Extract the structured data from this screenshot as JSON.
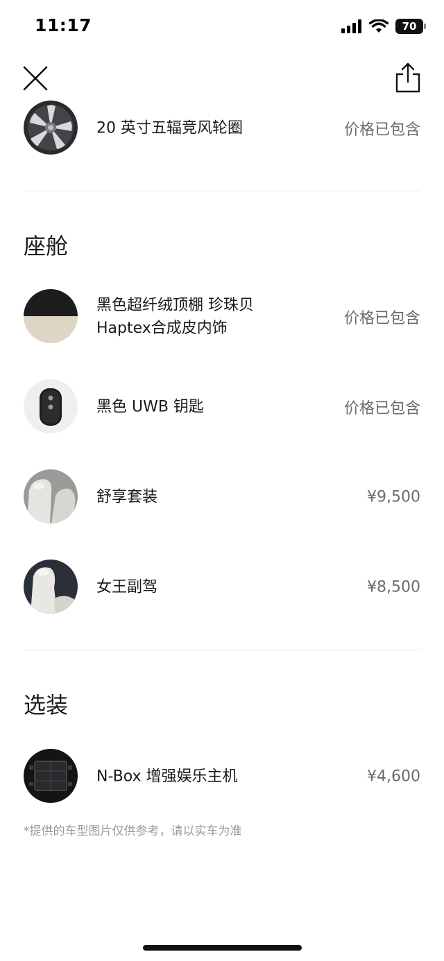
{
  "status_bar": {
    "time": "11:17",
    "battery": "70"
  },
  "items_top": [
    {
      "name": "20 英寸五辐竞风轮圈",
      "price": "价格已包含",
      "thumb": "wheel-rim"
    }
  ],
  "sections": [
    {
      "title": "座舱",
      "items": [
        {
          "name_line1": "黑色超纤绒顶棚 珍珠贝",
          "name_line2": "Haptex合成皮内饰",
          "price": "价格已包含",
          "thumb": "interior-swatch"
        },
        {
          "name_line1": "黑色 UWB 钥匙",
          "price": "价格已包含",
          "thumb": "car-key"
        },
        {
          "name_line1": "舒享套装",
          "price": "¥9,500",
          "thumb": "seat-package"
        },
        {
          "name_line1": "女王副驾",
          "price": "¥8,500",
          "thumb": "queen-seat"
        }
      ]
    },
    {
      "title": "选装",
      "items": [
        {
          "name_line1": "N-Box 增强娱乐主机",
          "price": "¥4,600",
          "thumb": "nbox-unit"
        }
      ]
    }
  ],
  "disclaimer": "*提供的车型图片仅供参考，请以实车为准",
  "colors": {
    "text_primary": "#1a1a1a",
    "text_secondary": "#6b6b6b",
    "text_muted": "#9a9a9a",
    "divider": "#e4e4e4"
  }
}
